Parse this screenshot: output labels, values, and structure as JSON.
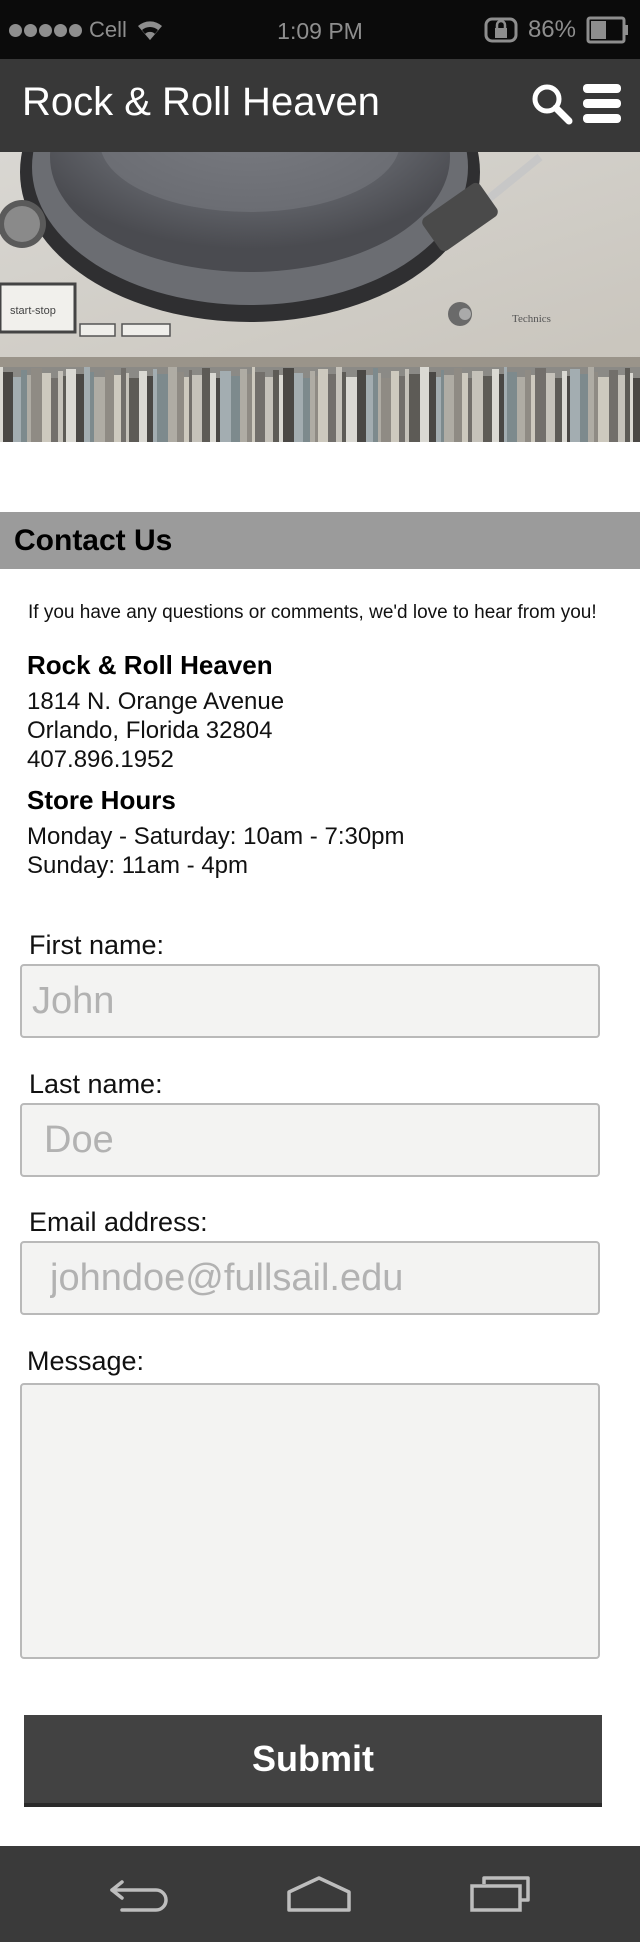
{
  "status_bar": {
    "carrier": "Cell",
    "time": "1:09 PM",
    "battery": "86%"
  },
  "header": {
    "title": "Rock & Roll Heaven",
    "icons": [
      "search-icon",
      "menu-icon"
    ]
  },
  "hero": {
    "turntable_label_button": "start-stop",
    "brand_text": "Technics"
  },
  "contact": {
    "heading": "Contact Us",
    "intro": "If you have any questions or comments, we'd love to hear from you!",
    "store_name": "Rock & Roll Heaven",
    "address_line1": "1814 N. Orange Avenue",
    "address_line2": "Orlando, Florida 32804",
    "phone": "407.896.1952",
    "hours_title": "Store Hours",
    "hours_line1": "Monday - Saturday: 10am - 7:30pm",
    "hours_line2": "Sunday: 11am - 4pm"
  },
  "form": {
    "first_name_label": "First name:",
    "first_name_placeholder": "John",
    "last_name_label": "Last name:",
    "last_name_placeholder": "Doe",
    "email_label": "Email address:",
    "email_placeholder": "johndoe@fullsail.edu",
    "message_label": "Message:",
    "message_placeholder": "",
    "submit_label": "Submit"
  },
  "nav_bar": {
    "icons": [
      "back-icon",
      "home-icon",
      "recent-apps-icon"
    ]
  }
}
